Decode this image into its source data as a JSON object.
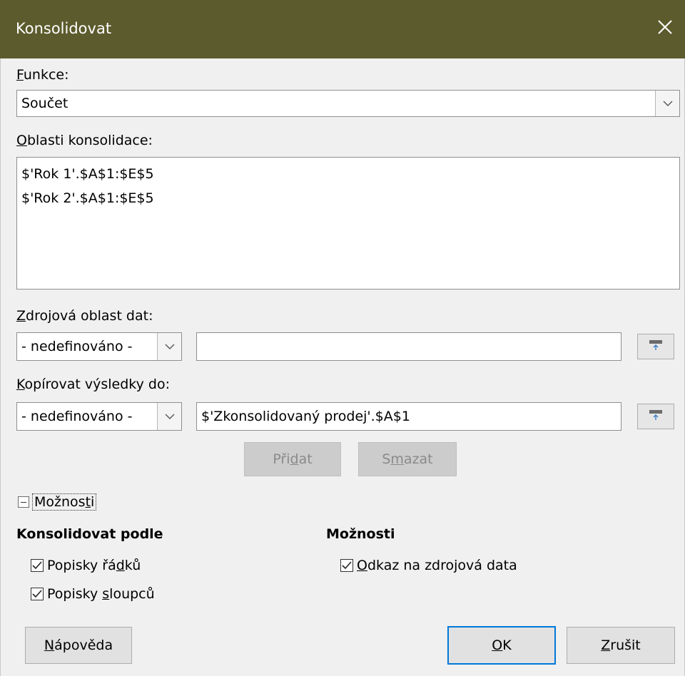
{
  "window": {
    "title": "Konsolidovat"
  },
  "function": {
    "label": "Funkce:",
    "mnemonic": "F",
    "value": "Součet"
  },
  "ranges": {
    "label": "Oblasti konsolidace:",
    "mnemonic": "O",
    "items": [
      "$'Rok 1'.$A$1:$E$5",
      "$'Rok 2'.$A$1:$E$5"
    ]
  },
  "source": {
    "label": "Zdrojová oblast dat:",
    "mnemonic": "Z",
    "combo_value": "- nedefinováno -",
    "input_value": ""
  },
  "dest": {
    "label": "Kopírovat výsledky do:",
    "mnemonic": "K",
    "combo_value": "- nedefinováno -",
    "input_value": "$'Zkonsolidovaný prodej'.$A$1"
  },
  "buttons": {
    "add": {
      "pre": "Při",
      "mn": "d",
      "post": "at"
    },
    "delete": {
      "pre": "S",
      "mn": "m",
      "post": "azat"
    },
    "help": {
      "pre": "",
      "mn": "N",
      "post": "ápověda"
    },
    "ok": {
      "pre": "",
      "mn": "O",
      "post": "K"
    },
    "cancel": {
      "pre": "",
      "mn": "Z",
      "post": "rušit"
    }
  },
  "options_expander": {
    "pre": "Možnos",
    "mn": "t",
    "post": "i"
  },
  "consolidate_by": {
    "heading": "Konsolidovat podle",
    "row_labels": {
      "pre": "Popisky řá",
      "mn": "d",
      "post": "ků",
      "checked": true
    },
    "col_labels": {
      "pre": "Popisky ",
      "mn": "s",
      "post": "loupců",
      "checked": true
    }
  },
  "options": {
    "heading": "Možnosti",
    "link": {
      "pre": "",
      "mn": "O",
      "post": "dkaz na zdrojová data",
      "checked": true
    }
  }
}
